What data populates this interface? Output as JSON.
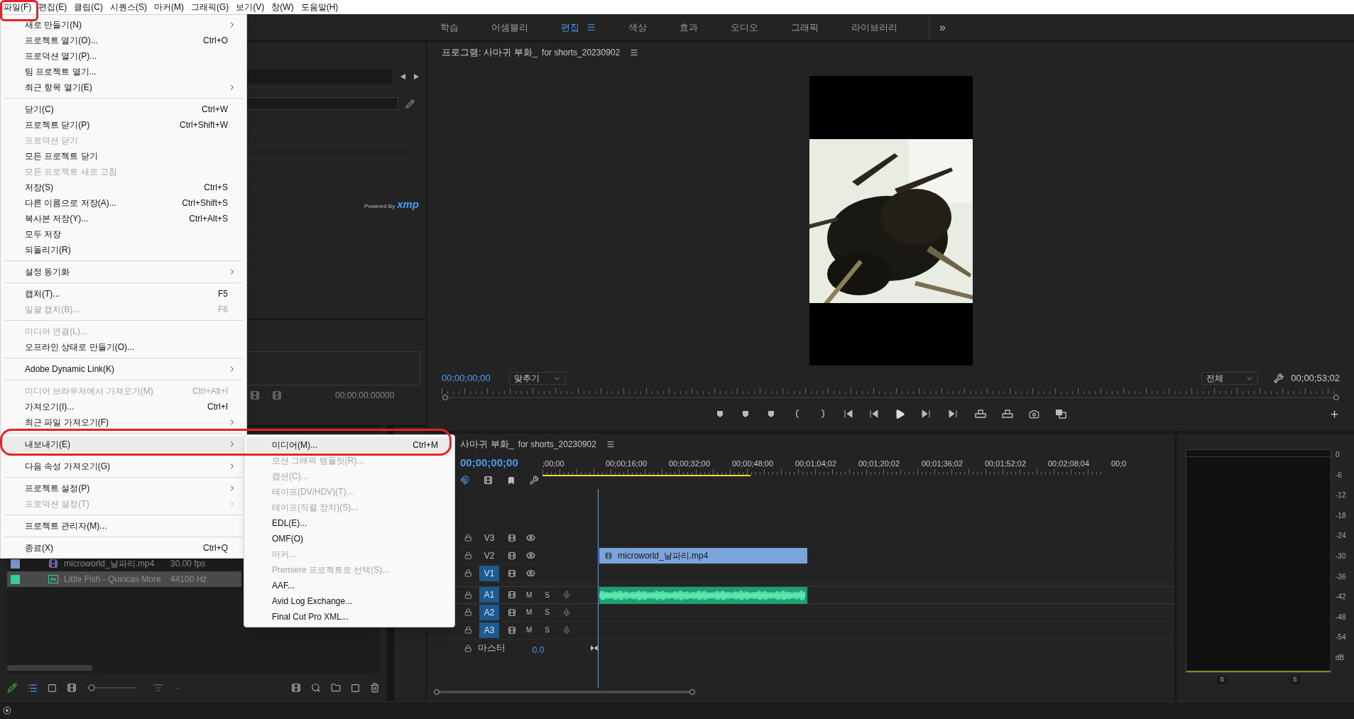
{
  "menu_bar": [
    "파일(F)",
    "편집(E)",
    "클립(C)",
    "시퀀스(S)",
    "마커(M)",
    "그래픽(G)",
    "보기(V)",
    "창(W)",
    "도움말(H)"
  ],
  "file_menu": [
    {
      "kind": "item",
      "label": "새로 만들기(N)",
      "submenu": true,
      "disabled": false,
      "selected": false
    },
    {
      "kind": "item",
      "label": "프로젝트 열기(O)...",
      "shortcut": "Ctrl+O",
      "submenu": false,
      "disabled": false,
      "selected": false
    },
    {
      "kind": "item",
      "label": "프로덕션 열기(P)...",
      "submenu": false,
      "disabled": false,
      "selected": false
    },
    {
      "kind": "item",
      "label": "팀 프로젝트 열기...",
      "submenu": false,
      "disabled": false,
      "selected": false
    },
    {
      "kind": "item",
      "label": "최근 항목 열기(E)",
      "submenu": true,
      "disabled": false,
      "selected": false
    },
    {
      "kind": "separator"
    },
    {
      "kind": "item",
      "label": "닫기(C)",
      "shortcut": "Ctrl+W",
      "submenu": false,
      "disabled": false,
      "selected": false
    },
    {
      "kind": "item",
      "label": "프로젝트 닫기(P)",
      "shortcut": "Ctrl+Shift+W",
      "submenu": false,
      "disabled": false,
      "selected": false
    },
    {
      "kind": "item",
      "label": "프로덕션 닫기",
      "submenu": false,
      "disabled": true,
      "selected": false
    },
    {
      "kind": "item",
      "label": "모든 프로젝트 닫기",
      "submenu": false,
      "disabled": false,
      "selected": false
    },
    {
      "kind": "item",
      "label": "모든 프로젝트 새로 고침",
      "submenu": false,
      "disabled": true,
      "selected": false
    },
    {
      "kind": "item",
      "label": "저장(S)",
      "shortcut": "Ctrl+S",
      "submenu": false,
      "disabled": false,
      "selected": false
    },
    {
      "kind": "item",
      "label": "다른 이름으로 저장(A)...",
      "shortcut": "Ctrl+Shift+S",
      "submenu": false,
      "disabled": false,
      "selected": false
    },
    {
      "kind": "item",
      "label": "복사본 저장(Y)...",
      "shortcut": "Ctrl+Alt+S",
      "submenu": false,
      "disabled": false,
      "selected": false
    },
    {
      "kind": "item",
      "label": "모두 저장",
      "submenu": false,
      "disabled": false,
      "selected": false
    },
    {
      "kind": "item",
      "label": "되돌리기(R)",
      "submenu": false,
      "disabled": false,
      "selected": false
    },
    {
      "kind": "separator"
    },
    {
      "kind": "item",
      "label": "설정 동기화",
      "submenu": true,
      "disabled": false,
      "selected": false
    },
    {
      "kind": "separator"
    },
    {
      "kind": "item",
      "label": "캡처(T)...",
      "shortcut": "F5",
      "submenu": false,
      "disabled": false,
      "selected": false
    },
    {
      "kind": "item",
      "label": "일괄 캡처(B)...",
      "shortcut": "F6",
      "submenu": false,
      "disabled": true,
      "selected": false
    },
    {
      "kind": "separator"
    },
    {
      "kind": "item",
      "label": "미디어 연결(L)...",
      "submenu": false,
      "disabled": true,
      "selected": false
    },
    {
      "kind": "item",
      "label": "오프라인 상태로 만들기(O)...",
      "submenu": false,
      "disabled": false,
      "selected": false
    },
    {
      "kind": "separator"
    },
    {
      "kind": "item",
      "label": "Adobe Dynamic Link(K)",
      "submenu": true,
      "disabled": false,
      "selected": false
    },
    {
      "kind": "separator"
    },
    {
      "kind": "item",
      "label": "미디어 브라우저에서 가져오기(M)",
      "shortcut": "Ctrl+Alt+I",
      "submenu": false,
      "disabled": true,
      "selected": false
    },
    {
      "kind": "item",
      "label": "가져오기(I)...",
      "shortcut": "Ctrl+I",
      "submenu": false,
      "disabled": false,
      "selected": false
    },
    {
      "kind": "item",
      "label": "최근 파일 가져오기(F)",
      "submenu": true,
      "disabled": false,
      "selected": false
    },
    {
      "kind": "separator"
    },
    {
      "kind": "item",
      "label": "내보내기(E)",
      "submenu": true,
      "disabled": false,
      "selected": true
    },
    {
      "kind": "separator"
    },
    {
      "kind": "item",
      "label": "다음 속성 가져오기(G)",
      "submenu": true,
      "disabled": false,
      "selected": false
    },
    {
      "kind": "separator"
    },
    {
      "kind": "item",
      "label": "프로젝트 설정(P)",
      "submenu": true,
      "disabled": false,
      "selected": false
    },
    {
      "kind": "item",
      "label": "프로덕션 설정(T)",
      "submenu": true,
      "disabled": true,
      "selected": false
    },
    {
      "kind": "separator"
    },
    {
      "kind": "item",
      "label": "프로젝트 관리자(M)...",
      "submenu": false,
      "disabled": false,
      "selected": false
    },
    {
      "kind": "separator"
    },
    {
      "kind": "item",
      "label": "종료(X)",
      "shortcut": "Ctrl+Q",
      "submenu": false,
      "disabled": false,
      "selected": false
    }
  ],
  "export_submenu": [
    {
      "label": "미디어(M)...",
      "shortcut": "Ctrl+M",
      "disabled": false,
      "selected": true
    },
    {
      "label": "모션 그래픽 템플릿(R)...",
      "disabled": true,
      "selected": false
    },
    {
      "label": "캡션(C)...",
      "disabled": true,
      "selected": false
    },
    {
      "label": "테이프(DV/HDV)(T)...",
      "disabled": true,
      "selected": false
    },
    {
      "label": "테이프(직렬 장치)(S)...",
      "disabled": true,
      "selected": false
    },
    {
      "label": "EDL(E)...",
      "disabled": false,
      "selected": false
    },
    {
      "label": "OMF(O)",
      "disabled": false,
      "selected": false
    },
    {
      "label": "마커...",
      "disabled": true,
      "selected": false
    },
    {
      "label": "Premiere 프로젝트로 선택(S)...",
      "disabled": true,
      "selected": false
    },
    {
      "label": "AAF...",
      "disabled": false,
      "selected": false
    },
    {
      "label": "Avid Log Exchange...",
      "disabled": false,
      "selected": false
    },
    {
      "label": "Final Cut Pro XML...",
      "disabled": false,
      "selected": false
    }
  ],
  "workspace_tabs": [
    {
      "label": "학습",
      "selected": false
    },
    {
      "label": "어셈블리",
      "selected": false
    },
    {
      "label": "편집",
      "selected": true
    },
    {
      "label": "색상",
      "selected": false
    },
    {
      "label": "효과",
      "selected": false
    },
    {
      "label": "오디오",
      "selected": false
    },
    {
      "label": "그래픽",
      "selected": false
    },
    {
      "label": "라이브러리",
      "selected": false
    }
  ],
  "workspace_overflow": "»",
  "left_panel": {
    "powered_by": "Powered By",
    "xmp": "xmp",
    "timecode": "00:00:00:00000"
  },
  "project_zoom": {
    "level": 0.05
  },
  "project_items": [
    {
      "name": "microworld_날파리.mp4",
      "rate": "30.00 fps",
      "color": "#7b9bd6",
      "kind": "video",
      "selected": false
    },
    {
      "name": "Little Fish - Quincas More",
      "rate": "44100 Hz",
      "color": "#2fd39a",
      "kind": "audio",
      "selected": true
    }
  ],
  "program_monitor": {
    "title": "프로그램: 사마귀 부화_",
    "title_suffix": "for shorts_20230902",
    "timecode": "00;00;00;00",
    "zoom": "맞추기",
    "resolution": "전체",
    "duration": "00;00;53;02"
  },
  "timeline": {
    "title": "사마귀 부화_",
    "title_suffix": "for shorts_20230902",
    "timecode": "00;00;00;00",
    "ruler": [
      ";00;00",
      "00;00;16;00",
      "00;00;32;00",
      "00;00;48;00",
      "00;01;04;02",
      "00;01;20;02",
      "00;01;36;02",
      "00;01;52;02",
      "00;02;08;04",
      "00;0"
    ],
    "tracks": [
      {
        "label": "V3",
        "kind": "video",
        "targeted": false
      },
      {
        "label": "V2",
        "kind": "video",
        "targeted": false,
        "clip": {
          "kind": "video",
          "label": "microworld_날파리.mp4"
        }
      },
      {
        "label": "V1",
        "kind": "video",
        "targeted": true
      },
      {
        "label": "A1",
        "kind": "audio",
        "targeted": true,
        "mute": "M",
        "solo": "S",
        "clip": {
          "kind": "audio"
        }
      },
      {
        "label": "A2",
        "kind": "audio",
        "targeted": true,
        "mute": "M",
        "solo": "S"
      },
      {
        "label": "A3",
        "kind": "audio",
        "targeted": true,
        "mute": "M",
        "solo": "S"
      }
    ],
    "master": {
      "label": "마스터",
      "value": "0.0"
    }
  },
  "audio_meter": {
    "scale": [
      "0",
      "-6",
      "-12",
      "-18",
      "-24",
      "-30",
      "-36",
      "-42",
      "-48",
      "-54",
      "dB"
    ],
    "solo": [
      "S",
      "S"
    ]
  }
}
